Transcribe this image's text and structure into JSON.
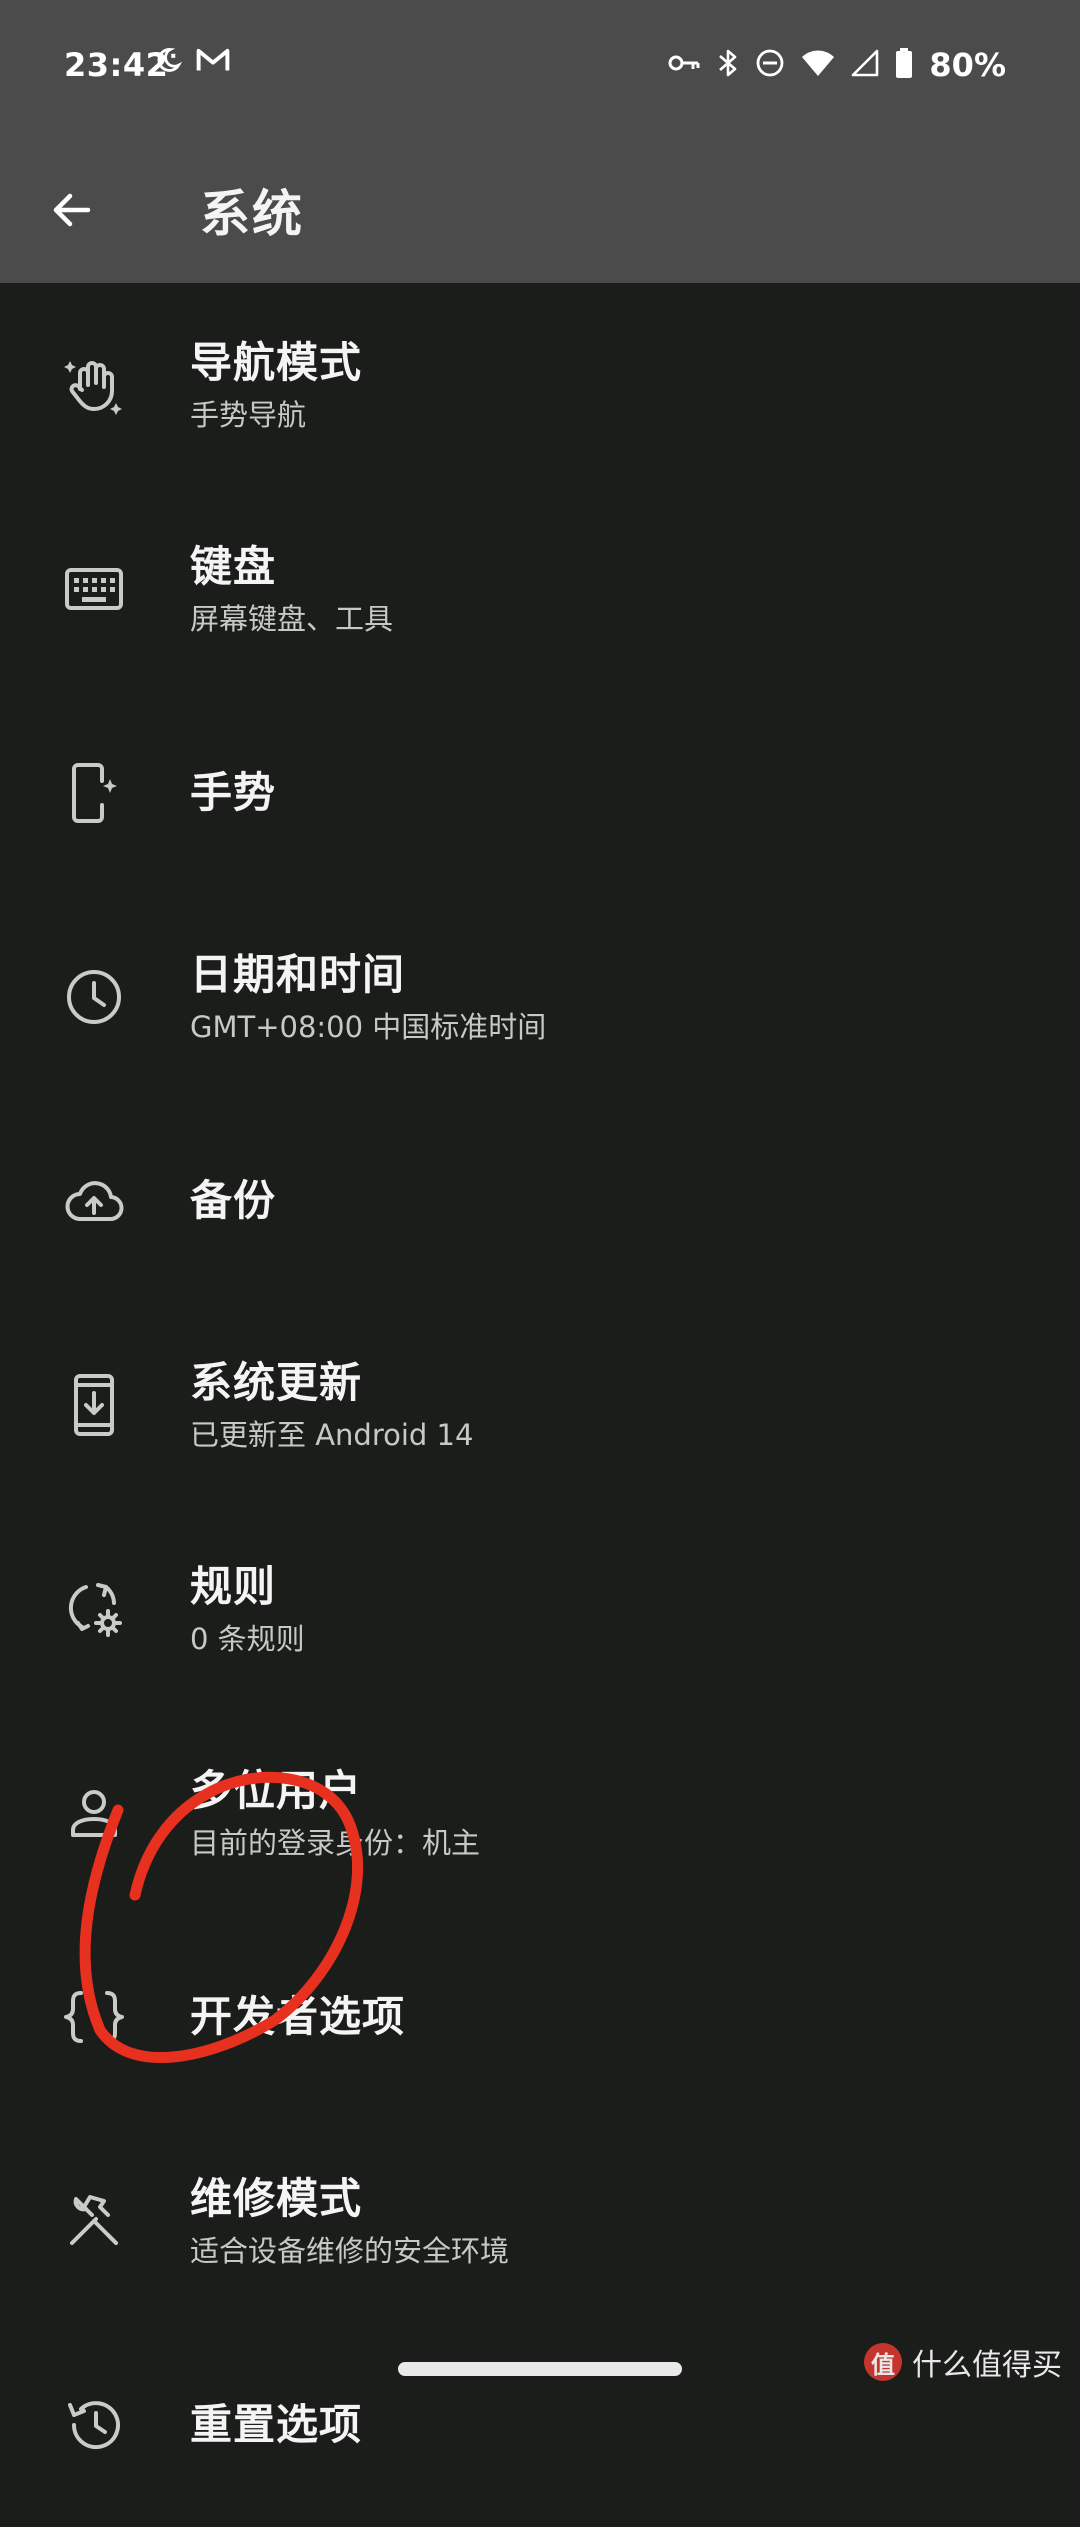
{
  "status_bar": {
    "time": "23:42",
    "battery": "80%",
    "left_icons": [
      "do-not-disturb-moon-icon",
      "gmail-icon"
    ],
    "right_icons": [
      "vpn-key-icon",
      "bluetooth-icon",
      "do-not-disturb-icon",
      "wifi-icon",
      "signal-icon",
      "battery-icon"
    ]
  },
  "app_bar": {
    "title": "系统"
  },
  "items": [
    {
      "icon": "gesture-hand-icon",
      "title": "导航模式",
      "subtitle": "手势导航"
    },
    {
      "icon": "keyboard-icon",
      "title": "键盘",
      "subtitle": "屏幕键盘、工具"
    },
    {
      "icon": "phone-gesture-icon",
      "title": "手势",
      "subtitle": ""
    },
    {
      "icon": "clock-icon",
      "title": "日期和时间",
      "subtitle": "GMT+08:00 中国标准时间"
    },
    {
      "icon": "cloud-upload-icon",
      "title": "备份",
      "subtitle": ""
    },
    {
      "icon": "system-update-icon",
      "title": "系统更新",
      "subtitle": "已更新至 Android 14"
    },
    {
      "icon": "rules-sync-icon",
      "title": "规则",
      "subtitle": "0 条规则"
    },
    {
      "icon": "person-icon",
      "title": "多位用户",
      "subtitle": "目前的登录身份：机主"
    },
    {
      "icon": "braces-icon",
      "title": "开发者选项",
      "subtitle": ""
    },
    {
      "icon": "tools-icon",
      "title": "维修模式",
      "subtitle": "适合设备维修的安全环境"
    },
    {
      "icon": "history-reset-icon",
      "title": "重置选项",
      "subtitle": ""
    }
  ],
  "watermark": {
    "logo": "值",
    "text": "什么值得买"
  },
  "colors": {
    "background": "#1b1d1b",
    "app_bar": "#4a4b4a",
    "annotation": "#e8301f"
  }
}
